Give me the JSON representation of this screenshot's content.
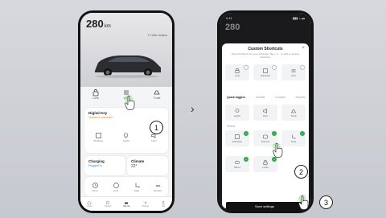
{
  "phone1": {
    "range_value": "280",
    "range_unit": "km",
    "header_right": "☀  Hello Jessica",
    "actions": [
      "Lock",
      "Vent",
      "Trunk"
    ],
    "card1": {
      "title": "Digital Key",
      "subtitle": "Vehicle is unlocked",
      "icons": [
        "Windows",
        "Lights",
        "Horn"
      ]
    },
    "card2": {
      "title": "Charging",
      "subtitle": "Plugged in"
    },
    "card3": {
      "title": "Climate",
      "value": "22°"
    },
    "card2_icons": [
      "Timer",
      "Limit",
      "Seat",
      "Defrost"
    ],
    "tabs": [
      "Home",
      "Control",
      "My car",
      "Charge",
      "Me"
    ]
  },
  "phone2": {
    "status_time": "9:41",
    "status_right": "▮▮▮ ◒ ▬",
    "range_value": "280",
    "sheet_title": "Custom Shortcuts",
    "sheet_desc": "Tap and hold to sort your shortcuts. Tap + or – to add or remove shortcuts.",
    "close": "×",
    "current": [
      "Lock",
      "Windows",
      "Vent"
    ],
    "categories": [
      "Quick toggles",
      "Climate",
      "Comfort",
      "Security"
    ],
    "row2": [
      "Lights",
      "Horn",
      "Trunk"
    ],
    "section_label": "Vehicle",
    "row3": [
      "Windows",
      "Sunroof",
      "Seat"
    ],
    "row4": [
      "Mirror",
      "Locks",
      ""
    ],
    "save_label": "Save settings"
  },
  "callouts": [
    "1",
    "2",
    "3"
  ],
  "chevron": "›"
}
